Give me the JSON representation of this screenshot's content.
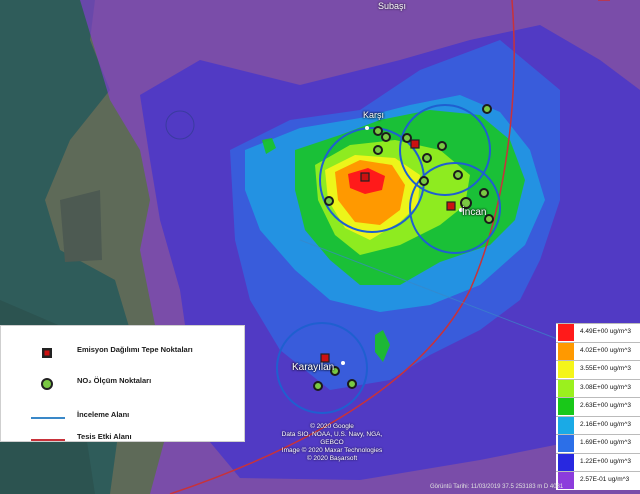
{
  "map": {
    "places": {
      "top_city": "Subaşı",
      "karsi": "Karşı",
      "incan": "İncan",
      "karayilan": "Karayılan"
    },
    "attribution": [
      "© 2020 Google",
      "Data SIO, NOAA, U.S. Navy, NGA, GEBCO",
      "Image © 2020 Maxar Technologies",
      "© 2020 Başarsoft"
    ],
    "bottom_note": "Görüntü Tarihi: 11/03/2019   37.5 253183 m D 4081"
  },
  "legend": {
    "items": [
      {
        "label": "Emisyon Dağılımı Tepe Noktaları",
        "icon": "emission-peak-square",
        "color": "#cc1111"
      },
      {
        "label": "NO₂ Ölçüm Noktaları",
        "icon": "measurement-point-circle",
        "color": "#7ac943"
      },
      {
        "label": "İnceleme Alanı",
        "icon": "line",
        "color": "#3a88c8"
      },
      {
        "label": "Tesis Etki Alanı",
        "icon": "line",
        "color": "#c8323a"
      }
    ]
  },
  "color_scale": {
    "unit": "ug/m³",
    "classes": [
      {
        "label": "4.49E+00 ug/m^3",
        "color": "#ff1a1a"
      },
      {
        "label": "4.02E+00 ug/m^3",
        "color": "#ff9900"
      },
      {
        "label": "3.55E+00 ug/m^3",
        "color": "#f5f51a"
      },
      {
        "label": "3.08E+00 ug/m^3",
        "color": "#9bf01e"
      },
      {
        "label": "2.63E+00 ug/m^3",
        "color": "#19c819"
      },
      {
        "label": "2.16E+00 ug/m^3",
        "color": "#1aaae6"
      },
      {
        "label": "1.69E+00 ug/m^3",
        "color": "#2c6fe8"
      },
      {
        "label": "1.22E+00 ug/m^3",
        "color": "#2828e0"
      },
      {
        "label": "2.57E-01 ug/m^3",
        "color": "#8c3cdc"
      }
    ]
  },
  "colors": {
    "sea": "#2f5c5a",
    "land": "#5e6a58",
    "boundary_blue": "#3a88c8",
    "boundary_red": "#c8323a"
  }
}
